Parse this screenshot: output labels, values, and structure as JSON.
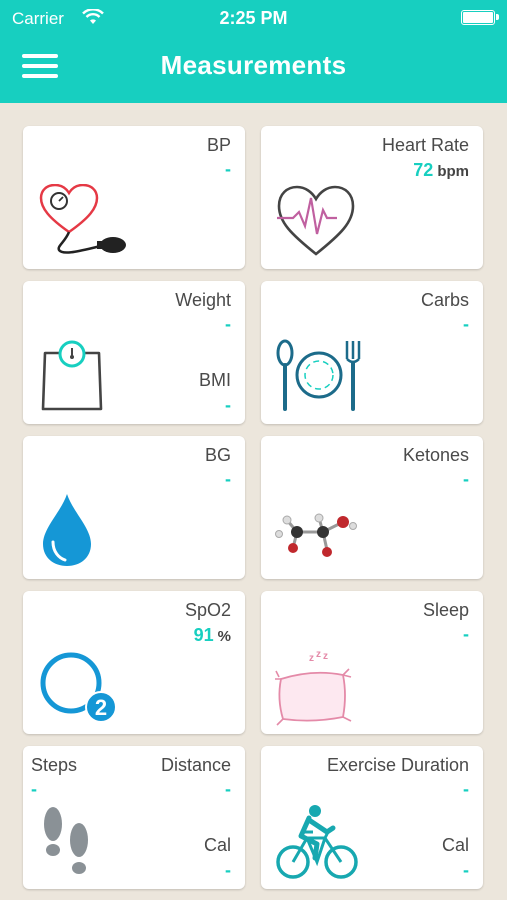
{
  "status_bar": {
    "carrier": "Carrier",
    "time": "2:25 PM"
  },
  "header": {
    "title": "Measurements",
    "menu_icon": "hamburger-menu-icon"
  },
  "colors": {
    "accent": "#17cfc0",
    "background": "#ece6dc"
  },
  "cards": {
    "bp": {
      "label": "BP",
      "value": "-",
      "icon": "blood-pressure-icon"
    },
    "heart_rate": {
      "label": "Heart Rate",
      "value": "72",
      "unit": "bpm",
      "icon": "heart-pulse-icon"
    },
    "weight": {
      "label": "Weight",
      "value": "-",
      "label2": "BMI",
      "value2": "-",
      "icon": "scale-icon"
    },
    "carbs": {
      "label": "Carbs",
      "value": "-",
      "icon": "plate-cutlery-icon"
    },
    "bg": {
      "label": "BG",
      "value": "-",
      "icon": "blood-drop-icon"
    },
    "ketones": {
      "label": "Ketones",
      "value": "-",
      "icon": "molecule-icon"
    },
    "spo2": {
      "label": "SpO2",
      "value": "91",
      "unit": "%",
      "icon": "oxygen-o2-icon"
    },
    "sleep": {
      "label": "Sleep",
      "value": "-",
      "icon": "pillow-icon"
    },
    "steps": {
      "label_left": "Steps",
      "value_left": "-",
      "label": "Distance",
      "value": "-",
      "label2": "Cal",
      "value2": "-",
      "icon": "footprints-icon"
    },
    "exercise": {
      "label": "Exercise Duration",
      "value": "-",
      "label2": "Cal",
      "value2": "-",
      "icon": "cyclist-icon"
    }
  }
}
